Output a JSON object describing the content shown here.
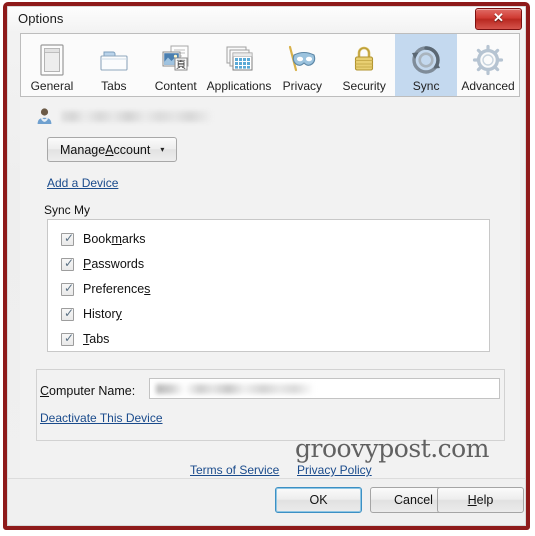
{
  "window": {
    "title": "Options",
    "close_label": "✕",
    "close_icon": "close-icon",
    "border_color": "#8e1a1a"
  },
  "toolbar": {
    "selected": "Sync",
    "selected_bg": "#c4d9ef",
    "tabs": [
      {
        "label": "General",
        "icon": "browser-window-icon"
      },
      {
        "label": "Tabs",
        "icon": "folder-tabs-icon"
      },
      {
        "label": "Content",
        "icon": "content-page-icon"
      },
      {
        "label": "Applications",
        "icon": "applications-windows-icon"
      },
      {
        "label": "Privacy",
        "icon": "privacy-mask-icon"
      },
      {
        "label": "Security",
        "icon": "security-padlock-icon"
      },
      {
        "label": "Sync",
        "icon": "sync-arrows-icon"
      },
      {
        "label": "Advanced",
        "icon": "advanced-gear-icon"
      }
    ]
  },
  "account": {
    "avatar_icon": "user-avatar-icon",
    "username": "",
    "username_redacted": true,
    "manage_button": {
      "prefix": "Manage ",
      "accel": "A",
      "suffix": "ccount",
      "caret": "▾"
    },
    "add_device_link": "Add a Device"
  },
  "sync": {
    "group_label": "Sync My",
    "items": [
      {
        "label": "Bookmarks",
        "prefix": "Book",
        "accel": "m",
        "suffix": "arks",
        "checked": true
      },
      {
        "label": "Passwords",
        "prefix": "",
        "accel": "P",
        "suffix": "asswords",
        "checked": true
      },
      {
        "label": "Preferences",
        "prefix": "Preference",
        "accel": "s",
        "suffix": "",
        "checked": true
      },
      {
        "label": "History",
        "prefix": "Histor",
        "accel": "y",
        "suffix": "",
        "checked": true
      },
      {
        "label": "Tabs",
        "prefix": "",
        "accel": "T",
        "suffix": "abs",
        "checked": true
      }
    ],
    "check_glyph": "✓"
  },
  "device": {
    "computer_name_label": {
      "accel": "C",
      "rest": "omputer Name:"
    },
    "computer_name_value": "",
    "computer_name_redacted": true,
    "deactivate_link": "Deactivate This Device"
  },
  "legal": {
    "terms_link": "Terms of Service",
    "privacy_link": "Privacy Policy"
  },
  "watermark": "groovypost.com",
  "footer": {
    "ok_label": "OK",
    "cancel_label": "Cancel",
    "help": {
      "accel": "H",
      "rest": "elp"
    }
  }
}
